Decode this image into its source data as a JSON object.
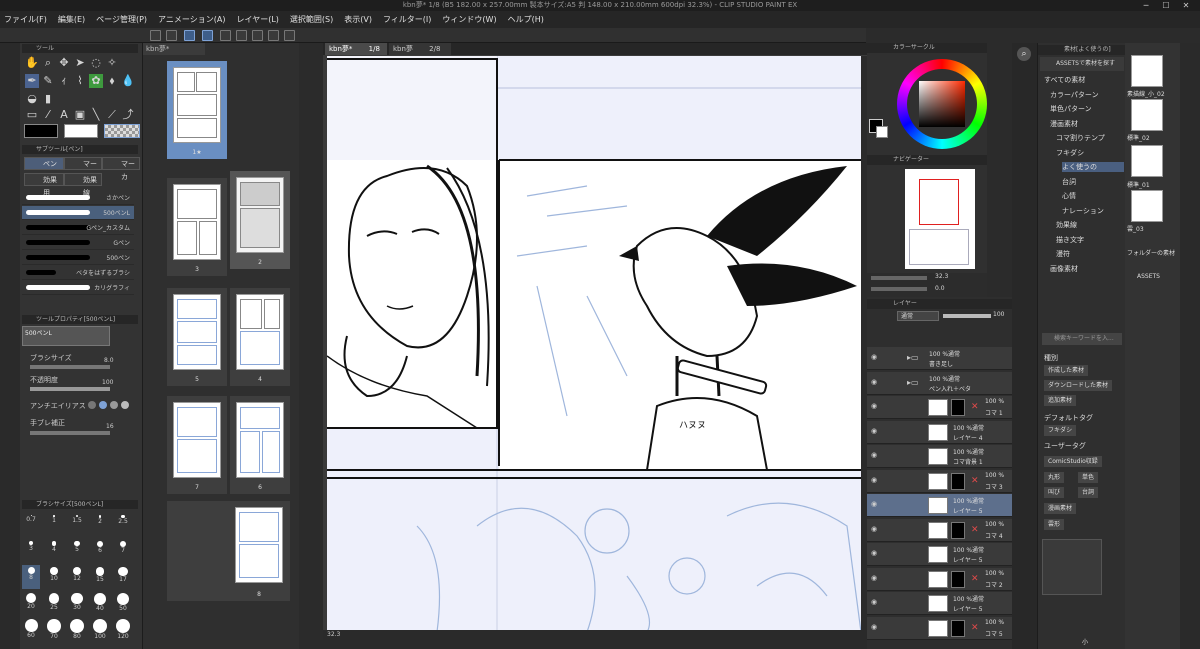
{
  "window": {
    "title": "kbn夢* 1/8 (B5 182.00 x 257.00mm 製本サイズ:A5 判 148.00 x 210.00mm 600dpi 32.3%) - CLIP STUDIO PAINT EX",
    "minimize": "─",
    "maximize": "☐",
    "close": "✕"
  },
  "menu": [
    "ファイル(F)",
    "編集(E)",
    "ページ管理(P)",
    "アニメーション(A)",
    "レイヤー(L)",
    "選択範囲(S)",
    "表示(V)",
    "フィルター(I)",
    "ウィンドウ(W)",
    "ヘルプ(H)"
  ],
  "tool_panel": {
    "title": "ツール",
    "sub_tool_title": "サブツール[ペン]",
    "sub_tabs": [
      "ペン",
      "マーカー",
      "マーカ",
      "効果用",
      "効果線"
    ],
    "brushes": [
      {
        "name": "さかペン",
        "color": "#ffffff"
      },
      {
        "name": "500ペンL",
        "color": "#ffffff"
      },
      {
        "name": "Gペン_カスタム",
        "color": "#000000"
      },
      {
        "name": "Gペン",
        "color": "#000000"
      },
      {
        "name": "500ペン",
        "color": "#000000"
      },
      {
        "name": "ベタをはずるブラシ",
        "color": "#000000"
      },
      {
        "name": "カリグラフィ",
        "color": "#ffffff"
      }
    ],
    "selected_brush": 1
  },
  "tool_property": {
    "title": "ツールプロパティ[500ペンL]",
    "brush_name": "500ペンL",
    "brush_size_label": "ブラシサイズ",
    "brush_size": "8.0",
    "opacity_label": "不透明度",
    "opacity": "100",
    "antialias_label": "アンチエイリアス",
    "stabilization_label": "手ブレ補正",
    "stabilization": "16"
  },
  "brush_size_panel": {
    "title": "ブラシサイズ[500ペンL]",
    "sizes": [
      "0.7",
      "1",
      "1.5",
      "2",
      "2.5",
      "3",
      "4",
      "5",
      "6",
      "7",
      "8",
      "10",
      "12",
      "15",
      "17",
      "20",
      "25",
      "30",
      "40",
      "50",
      "60",
      "70",
      "80",
      "100",
      "120"
    ],
    "selected": "8"
  },
  "page_manager": {
    "tab": "kbn夢*",
    "pages": [
      {
        "label": "1★",
        "selected": true
      },
      {
        "label": "3",
        "selected": false
      },
      {
        "label": "2",
        "selected": false
      },
      {
        "label": "5",
        "selected": false
      },
      {
        "label": "4",
        "selected": false
      },
      {
        "label": "7",
        "selected": false
      },
      {
        "label": "6",
        "selected": false
      },
      {
        "label": "8",
        "selected": false
      }
    ]
  },
  "document_tabs": [
    {
      "name": "kbn夢*",
      "page": "1/8"
    },
    {
      "name": "kbn夢",
      "page": "2/8"
    }
  ],
  "canvas": {
    "zoom": "32.3",
    "sign_text": "ハヌヌ"
  },
  "color_panel": {
    "title": "カラーサークル"
  },
  "navigator": {
    "title": "ナビゲーター",
    "zoom": "32.3",
    "rotation": "0.0"
  },
  "layer_panel": {
    "title": "レイヤー",
    "blend_mode": "通常",
    "opacity": "100",
    "layers": [
      {
        "line1": "100 %通常",
        "line2": "書き足し",
        "kind": "folder"
      },
      {
        "line1": "100 %通常",
        "line2": "ペン入れ＋ベタ",
        "kind": "folder"
      },
      {
        "line1": "100 %",
        "line2": "コマ 1",
        "kind": "frame"
      },
      {
        "line1": "100 %通常",
        "line2": "レイヤー 4",
        "kind": "layer"
      },
      {
        "line1": "100 %通常",
        "line2": "コマ背景 1",
        "kind": "layer"
      },
      {
        "line1": "100 %",
        "line2": "コマ 3",
        "kind": "frame"
      },
      {
        "line1": "100 %通常",
        "line2": "レイヤー 5",
        "kind": "layer",
        "selected": true
      },
      {
        "line1": "100 %",
        "line2": "コマ 4",
        "kind": "frame"
      },
      {
        "line1": "100 %通常",
        "line2": "レイヤー 5",
        "kind": "layer"
      },
      {
        "line1": "100 %",
        "line2": "コマ 2",
        "kind": "frame"
      },
      {
        "line1": "100 %通常",
        "line2": "レイヤー 5",
        "kind": "layer"
      },
      {
        "line1": "100 %",
        "line2": "コマ 5",
        "kind": "frame"
      }
    ]
  },
  "material_panel": {
    "title": "素材[よく使うの]",
    "assets_link": "ASSETSで素材を探す",
    "tree": [
      "すべての素材",
      "カラーパターン",
      "単色パターン",
      "漫画素材",
      "コマ割りテンプ",
      "フキダシ",
      "よく使うの",
      "台詞",
      "心情",
      "ナレーション",
      "効果線",
      "描き文字",
      "漫符",
      "画像素材"
    ],
    "selected_tree": "よく使うの",
    "search_placeholder": "検索キーワードを入...",
    "kind_label": "種別",
    "kind_tags": [
      "作成した素材",
      "ダウンロードした素材",
      "追加素材"
    ],
    "default_tag_label": "デフォルトタグ",
    "default_tags": [
      "フキダシ"
    ],
    "user_tag_label": "ユーザータグ",
    "user_tags": [
      "ComicStudio収録",
      "丸形",
      "単色",
      "叫び",
      "台詞",
      "漫画素材",
      "雲形"
    ],
    "size_label": "小"
  },
  "material_thumbs": [
    {
      "label": "素描線_小_02"
    },
    {
      "label": "標準_02"
    },
    {
      "label": "標準_01"
    },
    {
      "label": "雲_03"
    },
    {
      "label": "フォルダーの素材"
    },
    {
      "label": "ASSETS"
    }
  ]
}
